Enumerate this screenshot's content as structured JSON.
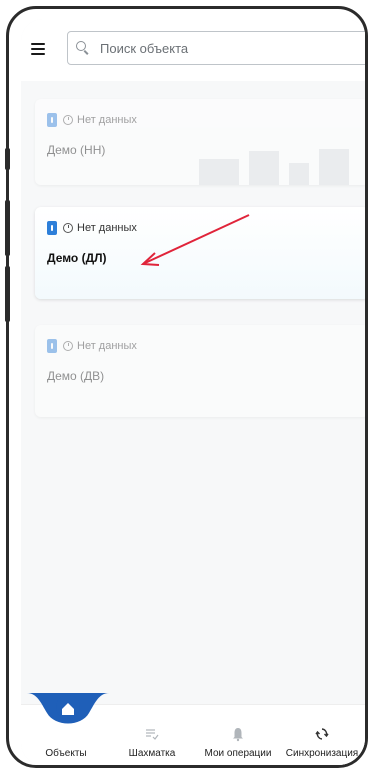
{
  "search": {
    "placeholder": "Поиск объекта"
  },
  "cards": [
    {
      "status": "Нет данных",
      "name": "Демо (НН)"
    },
    {
      "status": "Нет данных",
      "name": "Демо (ДЛ)"
    },
    {
      "status": "Нет данных",
      "name": "Демо (ДВ)"
    }
  ],
  "tabs": [
    {
      "label": "Объекты"
    },
    {
      "label": "Шахматка"
    },
    {
      "label": "Мои операции"
    },
    {
      "label": "Синхронизация"
    }
  ],
  "colors": {
    "accent": "#1f5fb8",
    "badge": "#2d7fd9",
    "arrow": "#e0243a"
  }
}
